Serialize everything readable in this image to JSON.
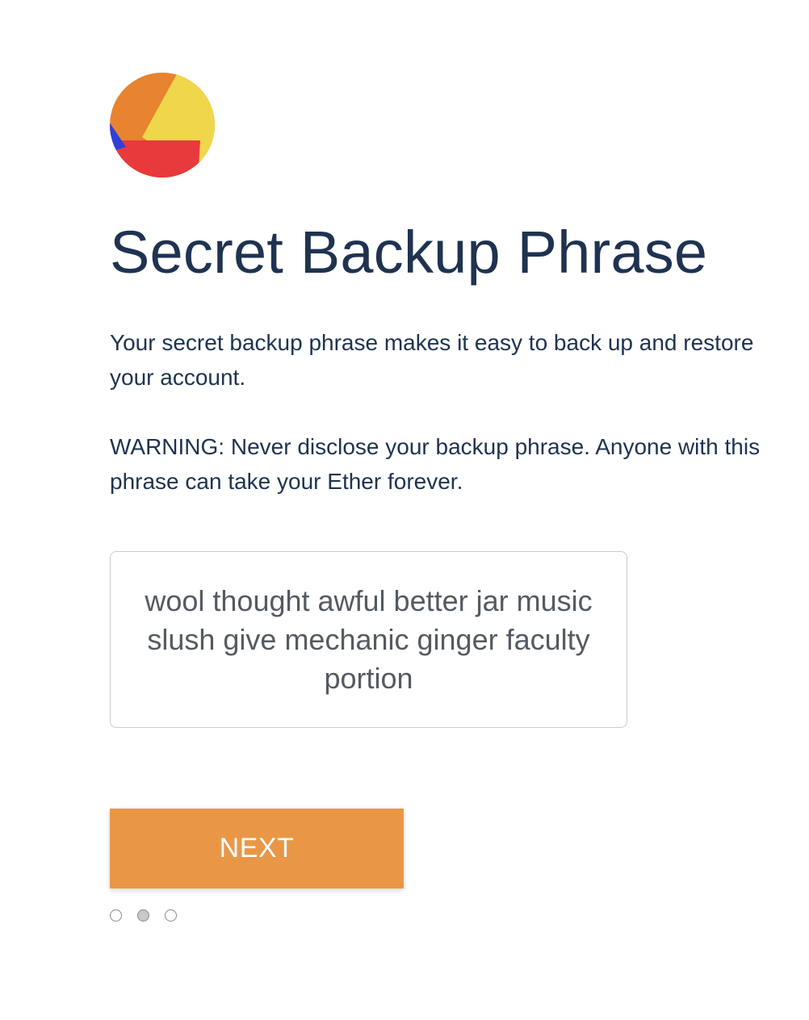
{
  "avatar": {
    "icon": "jazzicon-avatar",
    "colors": [
      "#e8832f",
      "#f0d64a",
      "#e8393c",
      "#2f3fd8"
    ]
  },
  "title": "Secret Backup Phrase",
  "intro": "Your secret backup phrase makes it easy to back up and restore your account.",
  "warning": "WARNING: Never disclose your backup phrase. Anyone with this phrase can take your Ether forever.",
  "phrase": "wool thought awful better jar music slush give mechanic ginger faculty portion",
  "next_label": "NEXT",
  "pagination": {
    "total": 3,
    "current": 2
  },
  "colors": {
    "heading": "#1f3350",
    "button": "#e99746",
    "phrase_text": "#555a61"
  }
}
